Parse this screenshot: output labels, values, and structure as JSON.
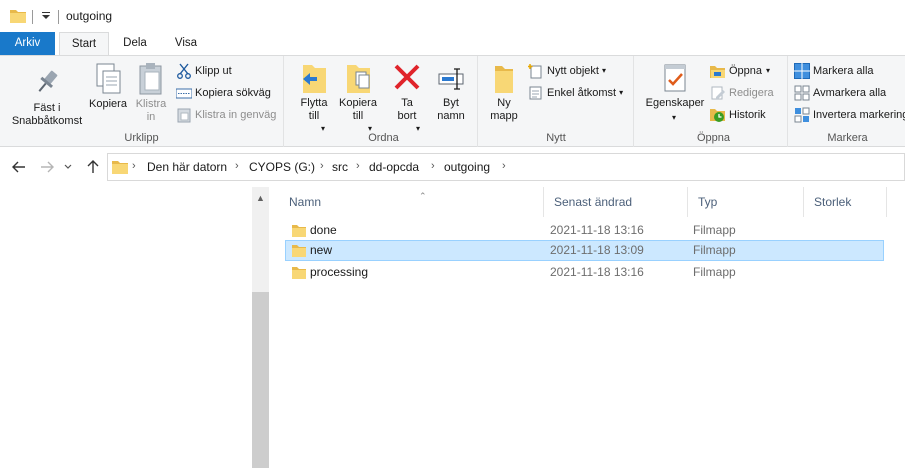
{
  "window": {
    "title": "outgoing"
  },
  "ribbon_tabs": [
    "Arkiv",
    "Start",
    "Dela",
    "Visa"
  ],
  "ribbon": {
    "clipboard": {
      "label": "Urklipp",
      "pin": "Fäst i\nSnabbåtkomst",
      "copy": "Kopiera",
      "paste": "Klistra\nin",
      "cut": "Klipp ut",
      "copy_path": "Kopiera sökväg",
      "paste_shortcut": "Klistra in genväg"
    },
    "organize": {
      "label": "Ordna",
      "move_to": "Flytta\ntill",
      "copy_to": "Kopiera\ntill",
      "delete": "Ta\nbort",
      "rename": "Byt\nnamn"
    },
    "new": {
      "label": "Nytt",
      "new_folder": "Ny\nmapp",
      "new_item": "Nytt objekt",
      "easy_access": "Enkel åtkomst"
    },
    "open": {
      "label": "Öppna",
      "properties": "Egenskaper",
      "open": "Öppna",
      "edit": "Redigera",
      "history": "Historik"
    },
    "select": {
      "label": "Markera",
      "select_all": "Markera alla",
      "select_none": "Avmarkera alla",
      "invert": "Invertera markering"
    }
  },
  "address": {
    "crumbs": [
      "Den här datorn",
      "CYOPS (G:)",
      "src",
      "dd-opcda",
      "outgoing"
    ]
  },
  "columns": [
    "Namn",
    "Senast ändrad",
    "Typ",
    "Storlek"
  ],
  "files": [
    {
      "name": "done",
      "modified": "2021-11-18 13:16",
      "type": "Filmapp",
      "selected": false
    },
    {
      "name": "new",
      "modified": "2021-11-18 13:09",
      "type": "Filmapp",
      "selected": true
    },
    {
      "name": "processing",
      "modified": "2021-11-18 13:16",
      "type": "Filmapp",
      "selected": false
    }
  ],
  "colors": {
    "accent": "#1979ca",
    "selection_bg": "#cce8ff",
    "selection_border": "#99d1ff",
    "folder": "#f8d775"
  }
}
